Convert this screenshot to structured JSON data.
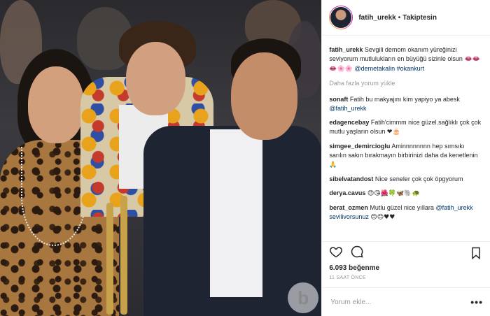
{
  "header": {
    "username": "fatih_urekk",
    "separator": "•",
    "follow_status": "Takiptesin"
  },
  "caption": {
    "username": "fatih_urekk",
    "text": "Sevgili demom okanım yüreğinizi seviyorum mutlulukların en büyüğü sizinle olsun",
    "emojis": "👄👄👄🌸🌸",
    "mentions": "@demetakalin #okankurt"
  },
  "load_more": "Daha fazla yorum yükle",
  "comments": [
    {
      "user": "sonaft",
      "text": "Fatih bu makyajını kim yapiyo ya abesk",
      "mention": "@fatih_urekk",
      "emoji": ""
    },
    {
      "user": "edagencebay",
      "text": "Fatih'cimmm nice güzel.sağlıklı çok çok mutlu yaşların olsun",
      "mention": "",
      "emoji": "❤🎂"
    },
    {
      "user": "simgee_demircioglu",
      "text": "Aminnnnnnnn hep sımsıkı sarılın sakın bırakmayın birbirinizi daha da kenetlenin",
      "mention": "",
      "emoji": "🙏"
    },
    {
      "user": "sibelvatandost",
      "text": "Nice seneler çok çok öpgyorum",
      "mention": "",
      "emoji": ""
    },
    {
      "user": "derya.cavus",
      "text": "",
      "mention": "",
      "emoji": "😍😘🌺🍀🦋🐘🐢"
    },
    {
      "user": "berat_ozmen",
      "text": "Mutlu güzel nice yıllara",
      "mention": "@fatih_urekk sevilivorsunuz",
      "emoji": "😊😊♥♥"
    }
  ],
  "likes": "6.093 beğenme",
  "timestamp": "11 SAAT ÖNCE",
  "add_comment": {
    "placeholder": "Yorum ekle...",
    "more_label": "•••"
  },
  "watermark": "b"
}
